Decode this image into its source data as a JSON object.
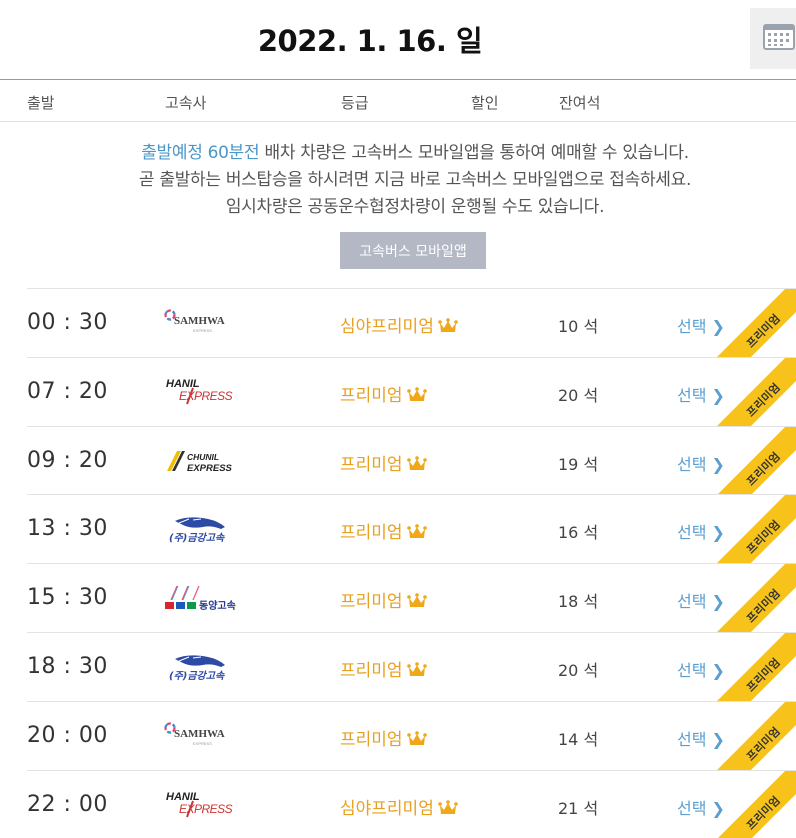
{
  "header": {
    "date": "2022. 1. 16. 일",
    "calendar_icon": "calendar-icon"
  },
  "columns": {
    "departure": "출발",
    "company": "고속사",
    "grade": "등급",
    "discount": "할인",
    "seats": "잔여석"
  },
  "notice": {
    "highlight": "출발예정 60분전",
    "line1_rest": " 배차 차량은 고속버스 모바일앱을 통하여 예매할 수 있습니다.",
    "line2": "곧 출발하는 버스탑승을 하시려면 지금 바로 고속버스 모바일앱으로 접속하세요.",
    "line3": "임시차량은 공동운수협정차량이 운행될 수도 있습니다.",
    "app_button": "고속버스 모바일앱"
  },
  "accent_colors": {
    "grade": "#e8a020",
    "link": "#5a9fd0",
    "highlight": "#4a97c8",
    "ribbon": "#f7c31a"
  },
  "schedules": [
    {
      "time": "00 : 30",
      "company_logo": "SAMHWA",
      "grade": "심야프리미엄",
      "seats": "10 석",
      "select": "선택",
      "badge": "프리미엄"
    },
    {
      "time": "07 : 20",
      "company_logo": "HANIL EXPRESS",
      "grade": "프리미엄",
      "seats": "20 석",
      "select": "선택",
      "badge": "프리미엄"
    },
    {
      "time": "09 : 20",
      "company_logo": "CHUNIL EXPRESS",
      "grade": "프리미엄",
      "seats": "19 석",
      "select": "선택",
      "badge": "프리미엄"
    },
    {
      "time": "13 : 30",
      "company_logo": "(주)금강고속",
      "grade": "프리미엄",
      "seats": "16 석",
      "select": "선택",
      "badge": "프리미엄"
    },
    {
      "time": "15 : 30",
      "company_logo": "동양고속",
      "grade": "프리미엄",
      "seats": "18 석",
      "select": "선택",
      "badge": "프리미엄"
    },
    {
      "time": "18 : 30",
      "company_logo": "(주)금강고속",
      "grade": "프리미엄",
      "seats": "20 석",
      "select": "선택",
      "badge": "프리미엄"
    },
    {
      "time": "20 : 00",
      "company_logo": "SAMHWA",
      "grade": "프리미엄",
      "seats": "14 석",
      "select": "선택",
      "badge": "프리미엄"
    },
    {
      "time": "22 : 00",
      "company_logo": "HANIL EXPRESS",
      "grade": "심야프리미엄",
      "seats": "21 석",
      "select": "선택",
      "badge": "프리미엄"
    }
  ]
}
